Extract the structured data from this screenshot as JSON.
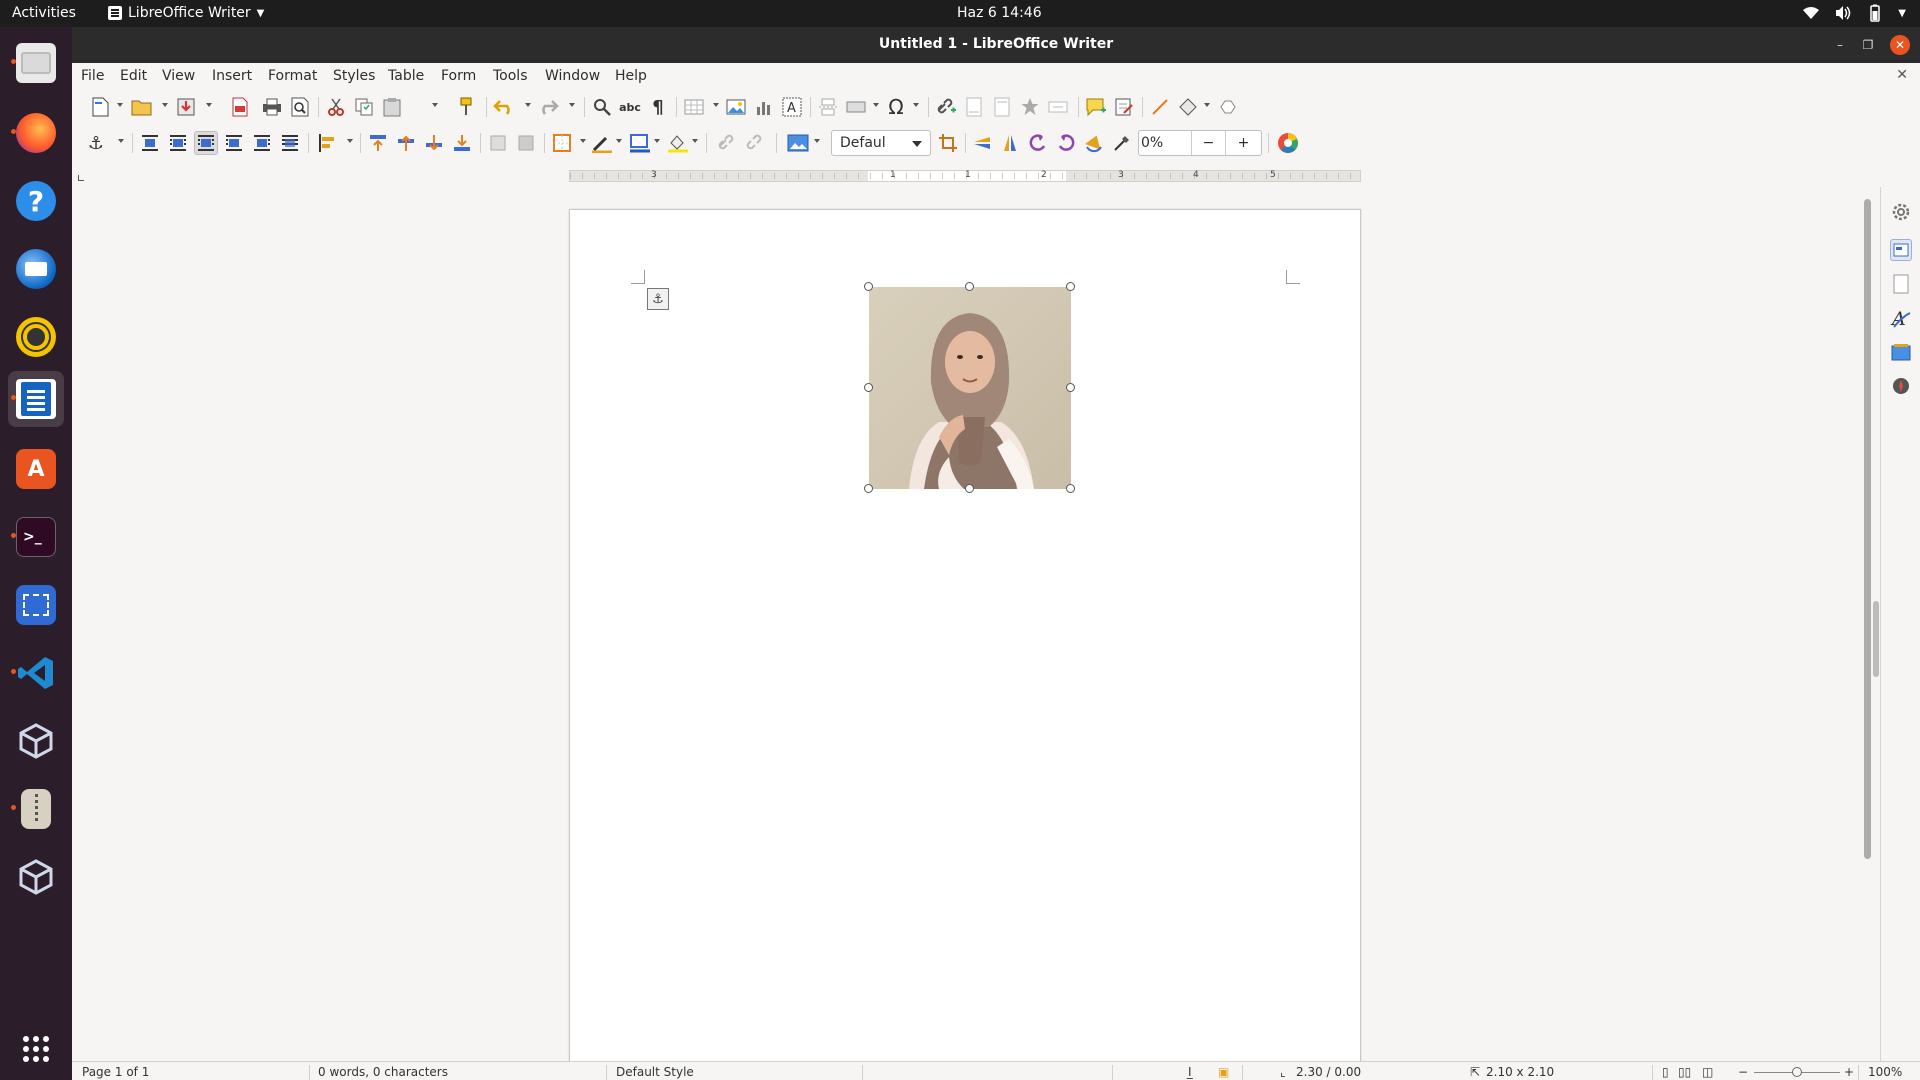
{
  "topbar": {
    "activities": "Activities",
    "app_name": "LibreOffice Writer",
    "clock": "Haz 6  14:46"
  },
  "window": {
    "title": "Untitled 1 - LibreOffice Writer"
  },
  "menu": [
    "File",
    "Edit",
    "View",
    "Insert",
    "Format",
    "Styles",
    "Table",
    "Form",
    "Tools",
    "Window",
    "Help"
  ],
  "toolbar2": {
    "frame_style": "Defaul",
    "transparency": "0%",
    "minus": "−",
    "plus": "+"
  },
  "ruler": {
    "labels": [
      "3",
      "1",
      "1",
      "2",
      "3",
      "4",
      "5"
    ]
  },
  "statusbar": {
    "page": "Page 1 of 1",
    "words": "0 words, 0 characters",
    "style": "Default Style",
    "position": "2.30 / 0.00",
    "size": "2.10 x 2.10",
    "zoom": "100%"
  },
  "dock": {
    "apps": [
      "files-icon",
      "firefox-icon",
      "help-icon",
      "thunderbird-icon",
      "rhythmbox-icon",
      "writer-icon",
      "software-icon",
      "terminal-icon",
      "screenshot-icon",
      "vscode-icon",
      "virtualbox-icon",
      "archive-icon",
      "virtualbox-icon-2",
      "app-grid-icon"
    ]
  },
  "colors": {
    "accent": "#e95420",
    "dock_bg": "#2b1d29",
    "topbar_bg": "#1d1d1d",
    "titlebar_bg": "#2c2c2c"
  }
}
